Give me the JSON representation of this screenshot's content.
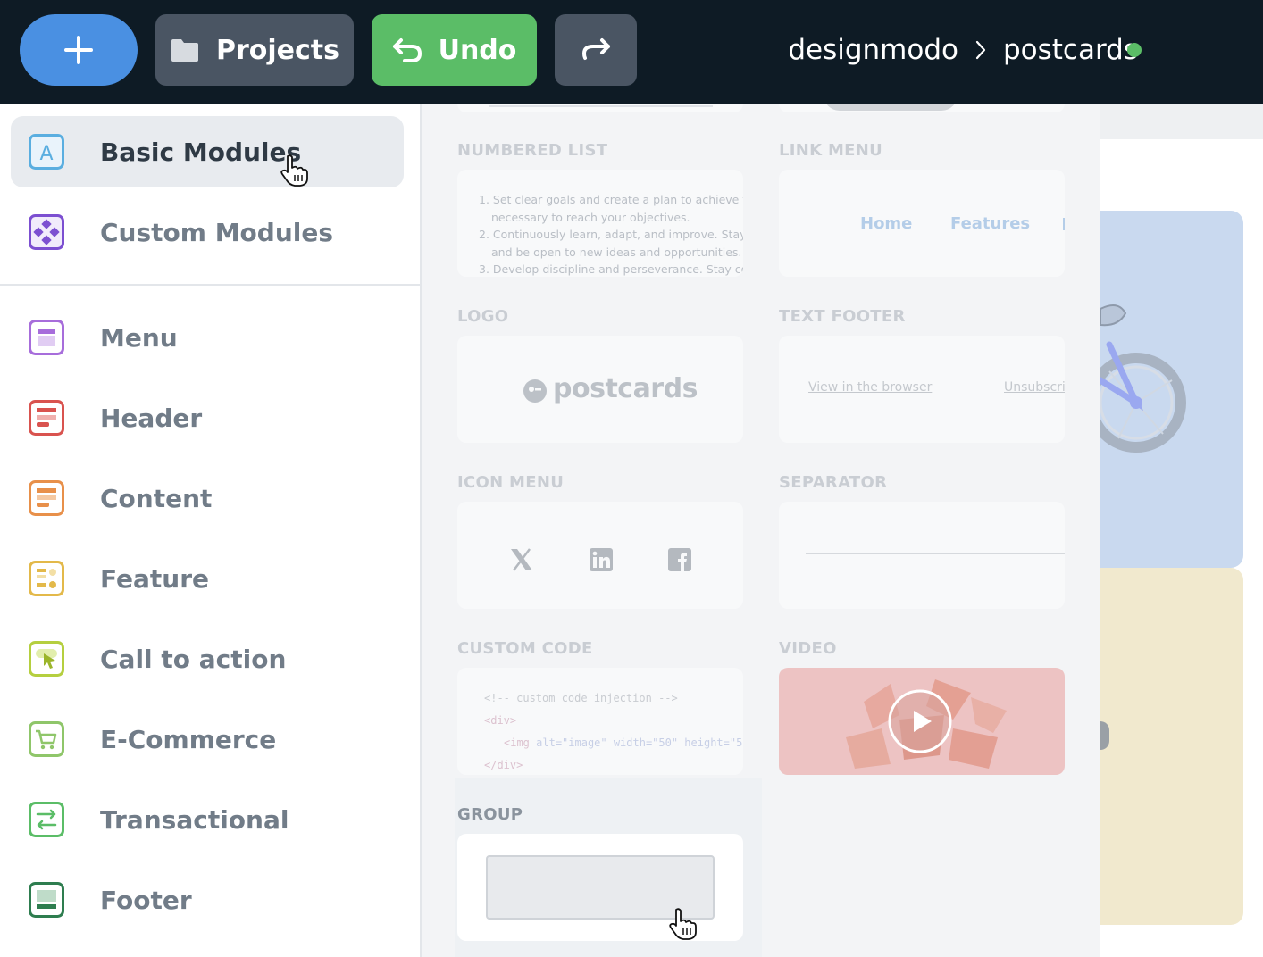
{
  "toolbar": {
    "add_button_label": "+",
    "projects_label": "Projects",
    "undo_label": "Undo",
    "redo_icon": "redo-arrow-icon"
  },
  "breadcrumb": {
    "workspace": "designmodo",
    "project": "postcards",
    "status_color": "#5bbd67"
  },
  "sidebar": {
    "primary": [
      {
        "label": "Basic Modules",
        "icon": "letter-a-icon",
        "active": true
      },
      {
        "label": "Custom Modules",
        "icon": "diamond-grid-icon",
        "active": false
      }
    ],
    "categories": [
      {
        "label": "Menu",
        "icon": "menu-module-icon",
        "color": "#9b6bd6"
      },
      {
        "label": "Header",
        "icon": "header-module-icon",
        "color": "#d9534f"
      },
      {
        "label": "Content",
        "icon": "content-module-icon",
        "color": "#e8904a"
      },
      {
        "label": "Feature",
        "icon": "feature-module-icon",
        "color": "#e3b94a"
      },
      {
        "label": "Call to action",
        "icon": "cta-module-icon",
        "color": "#b5cf3f"
      },
      {
        "label": "E-Commerce",
        "icon": "cart-module-icon",
        "color": "#8fc66a"
      },
      {
        "label": "Transactional",
        "icon": "transactional-module-icon",
        "color": "#5bbd67"
      },
      {
        "label": "Footer",
        "icon": "footer-module-icon",
        "color": "#2e7d4f"
      }
    ]
  },
  "modules": {
    "numbered_list": {
      "title": "NUMBERED LIST",
      "items": [
        "1. Set clear goals and create a plan to achieve the",
        "necessary to reach your objectives.",
        "2. Continuously learn, adapt, and improve. Stay cu",
        "and be open to new ideas and opportunities.",
        "3. Develop discipline and perseverance. Stay com"
      ]
    },
    "link_menu": {
      "title": "LINK MENU",
      "links": [
        "Home",
        "Features"
      ]
    },
    "logo": {
      "title": "LOGO",
      "brand": "postcards"
    },
    "text_footer": {
      "title": "TEXT FOOTER",
      "links": [
        "View in the browser",
        "Unsubscri"
      ]
    },
    "icon_menu": {
      "title": "ICON MENU",
      "icons": [
        "x-icon",
        "linkedin-icon",
        "facebook-icon"
      ]
    },
    "separator": {
      "title": "SEPARATOR"
    },
    "custom_code": {
      "title": "CUSTOM CODE",
      "line1": "<!-- custom code injection -->",
      "line2": "<div>",
      "line3_tag": "<img",
      "line3_attrs": "alt=\"image\" width=\"50\" height=\"5",
      "line4": "</div>"
    },
    "video": {
      "title": "VIDEO"
    },
    "group": {
      "title": "GROUP"
    }
  }
}
